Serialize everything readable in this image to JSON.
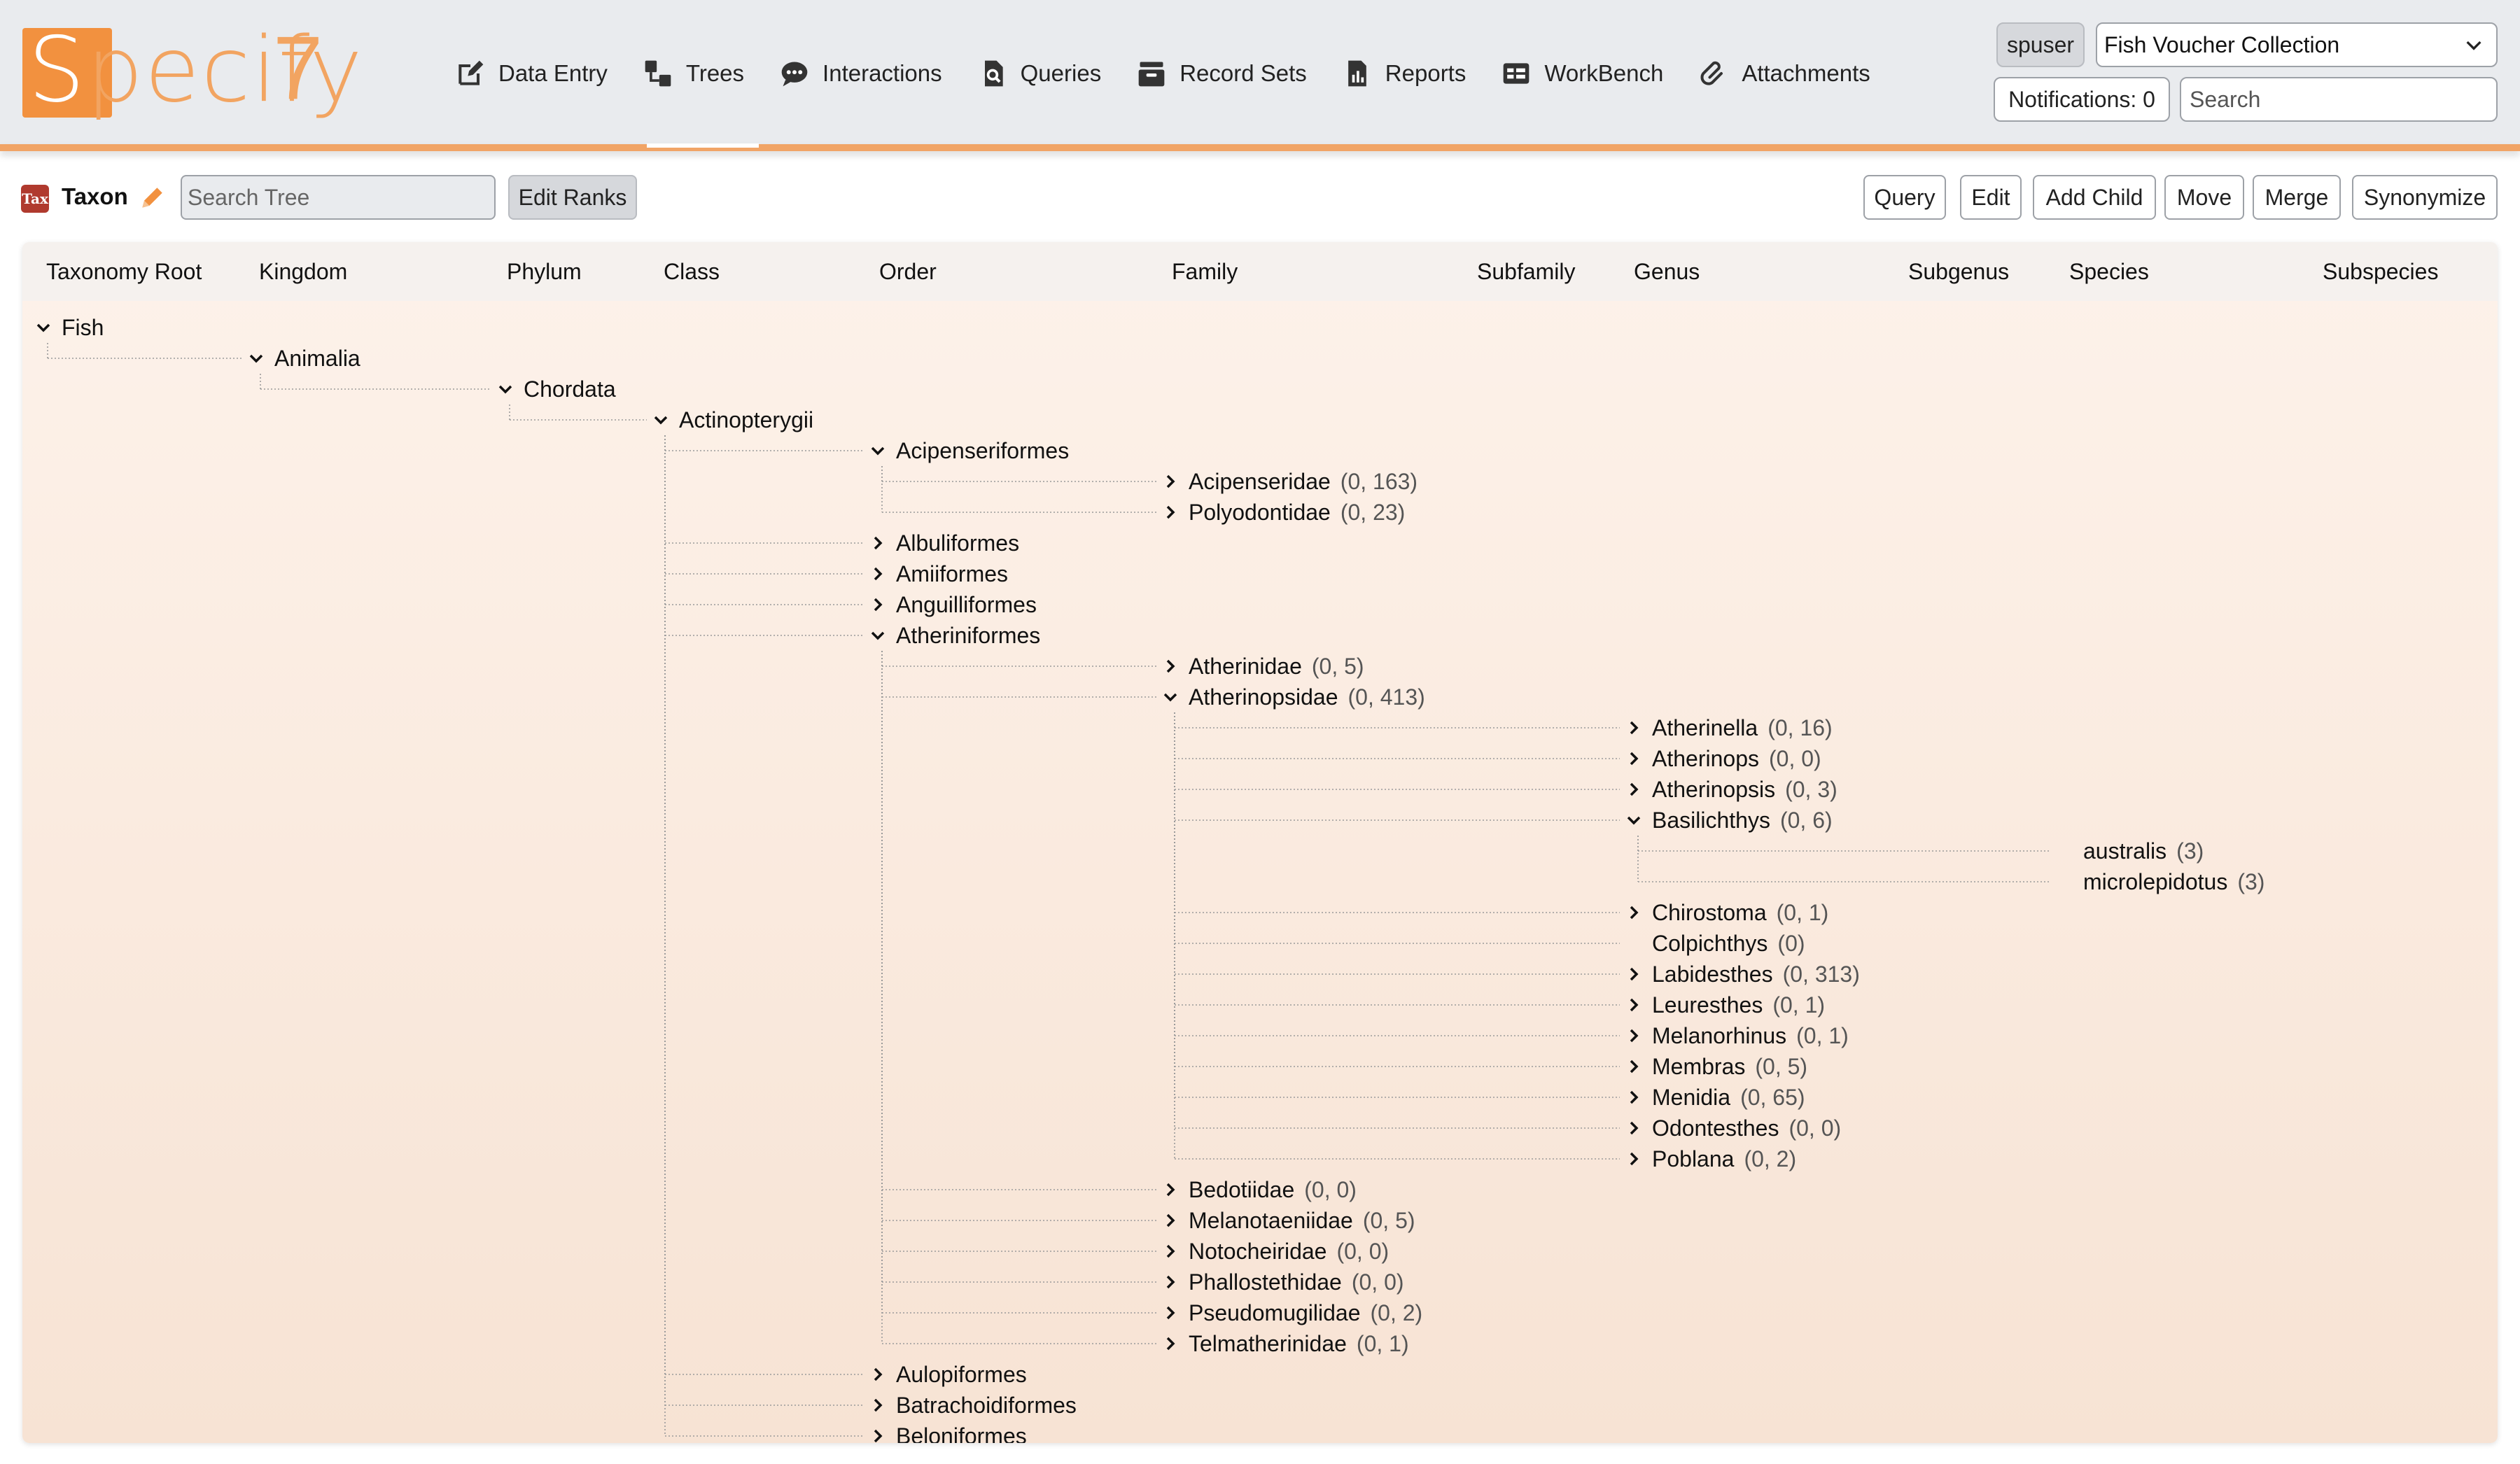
{
  "header": {
    "logo_text": "Specify",
    "logo_version": "7",
    "nav": [
      {
        "label": "Data Entry",
        "icon": "edit-icon"
      },
      {
        "label": "Trees",
        "icon": "tree-icon"
      },
      {
        "label": "Interactions",
        "icon": "chat-icon"
      },
      {
        "label": "Queries",
        "icon": "query-icon"
      },
      {
        "label": "Record Sets",
        "icon": "record-sets-icon"
      },
      {
        "label": "Reports",
        "icon": "reports-icon"
      },
      {
        "label": "WorkBench",
        "icon": "workbench-icon"
      },
      {
        "label": "Attachments",
        "icon": "attachment-icon"
      }
    ],
    "active_nav": "Trees",
    "user": "spuser",
    "collection": "Fish Voucher Collection",
    "notifications": "Notifications: 0",
    "search_placeholder": "Search"
  },
  "toolbar": {
    "badge": "Tax",
    "title": "Taxon",
    "search_placeholder": "Search Tree",
    "edit_ranks": "Edit Ranks",
    "actions": [
      "Query",
      "Edit",
      "Add Child",
      "Move",
      "Merge",
      "Synonymize"
    ]
  },
  "ranks": [
    "Taxonomy Root",
    "Kingdom",
    "Phylum",
    "Class",
    "Order",
    "Family",
    "Subfamily",
    "Genus",
    "Subgenus",
    "Species",
    "Subspecies"
  ],
  "tree": [
    {
      "name": "Fish",
      "rank": 0,
      "state": "open"
    },
    {
      "name": "Animalia",
      "rank": 1,
      "state": "open"
    },
    {
      "name": "Chordata",
      "rank": 2,
      "state": "open"
    },
    {
      "name": "Actinopterygii",
      "rank": 3,
      "state": "open"
    },
    {
      "name": "Acipenseriformes",
      "rank": 4,
      "state": "open"
    },
    {
      "name": "Acipenseridae",
      "rank": 5,
      "state": "closed",
      "count": "(0, 163)"
    },
    {
      "name": "Polyodontidae",
      "rank": 5,
      "state": "closed",
      "count": "(0, 23)"
    },
    {
      "name": "Albuliformes",
      "rank": 4,
      "state": "closed"
    },
    {
      "name": "Amiiformes",
      "rank": 4,
      "state": "closed"
    },
    {
      "name": "Anguilliformes",
      "rank": 4,
      "state": "closed"
    },
    {
      "name": "Atheriniformes",
      "rank": 4,
      "state": "open"
    },
    {
      "name": "Atherinidae",
      "rank": 5,
      "state": "closed",
      "count": "(0, 5)"
    },
    {
      "name": "Atherinopsidae",
      "rank": 5,
      "state": "open",
      "count": "(0, 413)"
    },
    {
      "name": "Atherinella",
      "rank": 7,
      "state": "closed",
      "count": "(0, 16)"
    },
    {
      "name": "Atherinops",
      "rank": 7,
      "state": "closed",
      "count": "(0, 0)"
    },
    {
      "name": "Atherinopsis",
      "rank": 7,
      "state": "closed",
      "count": "(0, 3)"
    },
    {
      "name": "Basilichthys",
      "rank": 7,
      "state": "open",
      "count": "(0, 6)"
    },
    {
      "name": "australis",
      "rank": 9,
      "state": "leaf",
      "count": "(3)"
    },
    {
      "name": "microlepidotus",
      "rank": 9,
      "state": "leaf",
      "count": "(3)"
    },
    {
      "name": "Chirostoma",
      "rank": 7,
      "state": "closed",
      "count": "(0, 1)"
    },
    {
      "name": "Colpichthys",
      "rank": 7,
      "state": "leaf",
      "count": "(0)"
    },
    {
      "name": "Labidesthes",
      "rank": 7,
      "state": "closed",
      "count": "(0, 313)"
    },
    {
      "name": "Leuresthes",
      "rank": 7,
      "state": "closed",
      "count": "(0, 1)"
    },
    {
      "name": "Melanorhinus",
      "rank": 7,
      "state": "closed",
      "count": "(0, 1)"
    },
    {
      "name": "Membras",
      "rank": 7,
      "state": "closed",
      "count": "(0, 5)"
    },
    {
      "name": "Menidia",
      "rank": 7,
      "state": "closed",
      "count": "(0, 65)"
    },
    {
      "name": "Odontesthes",
      "rank": 7,
      "state": "closed",
      "count": "(0, 0)"
    },
    {
      "name": "Poblana",
      "rank": 7,
      "state": "closed",
      "count": "(0, 2)"
    },
    {
      "name": "Bedotiidae",
      "rank": 5,
      "state": "closed",
      "count": "(0, 0)"
    },
    {
      "name": "Melanotaeniidae",
      "rank": 5,
      "state": "closed",
      "count": "(0, 5)"
    },
    {
      "name": "Notocheiridae",
      "rank": 5,
      "state": "closed",
      "count": "(0, 0)"
    },
    {
      "name": "Phallostethidae",
      "rank": 5,
      "state": "closed",
      "count": "(0, 0)"
    },
    {
      "name": "Pseudomugilidae",
      "rank": 5,
      "state": "closed",
      "count": "(0, 2)"
    },
    {
      "name": "Telmatherinidae",
      "rank": 5,
      "state": "closed",
      "count": "(0, 1)"
    },
    {
      "name": "Aulopiformes",
      "rank": 4,
      "state": "closed"
    },
    {
      "name": "Batrachoidiformes",
      "rank": 4,
      "state": "closed"
    },
    {
      "name": "Beloniformes",
      "rank": 4,
      "state": "closed"
    }
  ]
}
